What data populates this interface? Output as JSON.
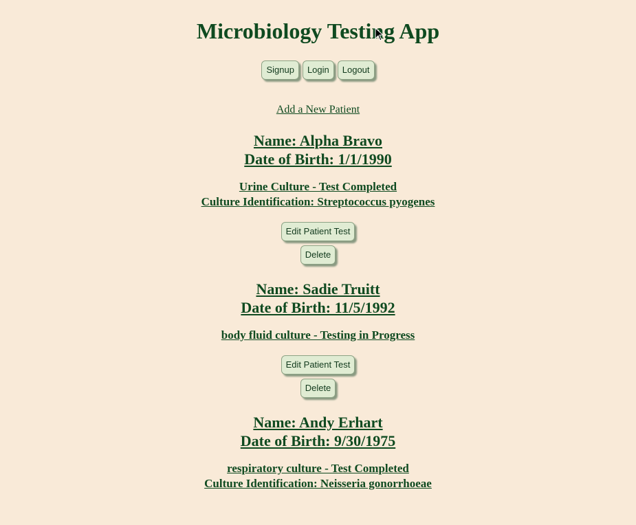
{
  "header": {
    "title": "Microbiology Testing App"
  },
  "nav": {
    "signup_label": "Signup",
    "login_label": "Login",
    "logout_label": "Logout"
  },
  "add_patient_link": "Add a New Patient",
  "patients": [
    {
      "name": "Name: Alpha Bravo",
      "dob": "Date of Birth: 1/1/1990",
      "test_line": "Urine Culture - Test Completed",
      "identification": "Culture Identification: Streptococcus pyogenes",
      "edit_label": "Edit Patient Test",
      "delete_label": "Delete"
    },
    {
      "name": "Name: Sadie Truitt",
      "dob": "Date of Birth: 11/5/1992",
      "test_line": "body fluid culture - Testing in Progress",
      "identification": "",
      "edit_label": "Edit Patient Test",
      "delete_label": "Delete"
    },
    {
      "name": "Name: Andy Erhart",
      "dob": "Date of Birth: 9/30/1975",
      "test_line": "respiratory culture - Test Completed",
      "identification": "Culture Identification: Neisseria gonorrhoeae"
    }
  ],
  "colors": {
    "background": "#f9ead8",
    "text": "#0f4a20",
    "button_bg": "#e0ecd3"
  }
}
